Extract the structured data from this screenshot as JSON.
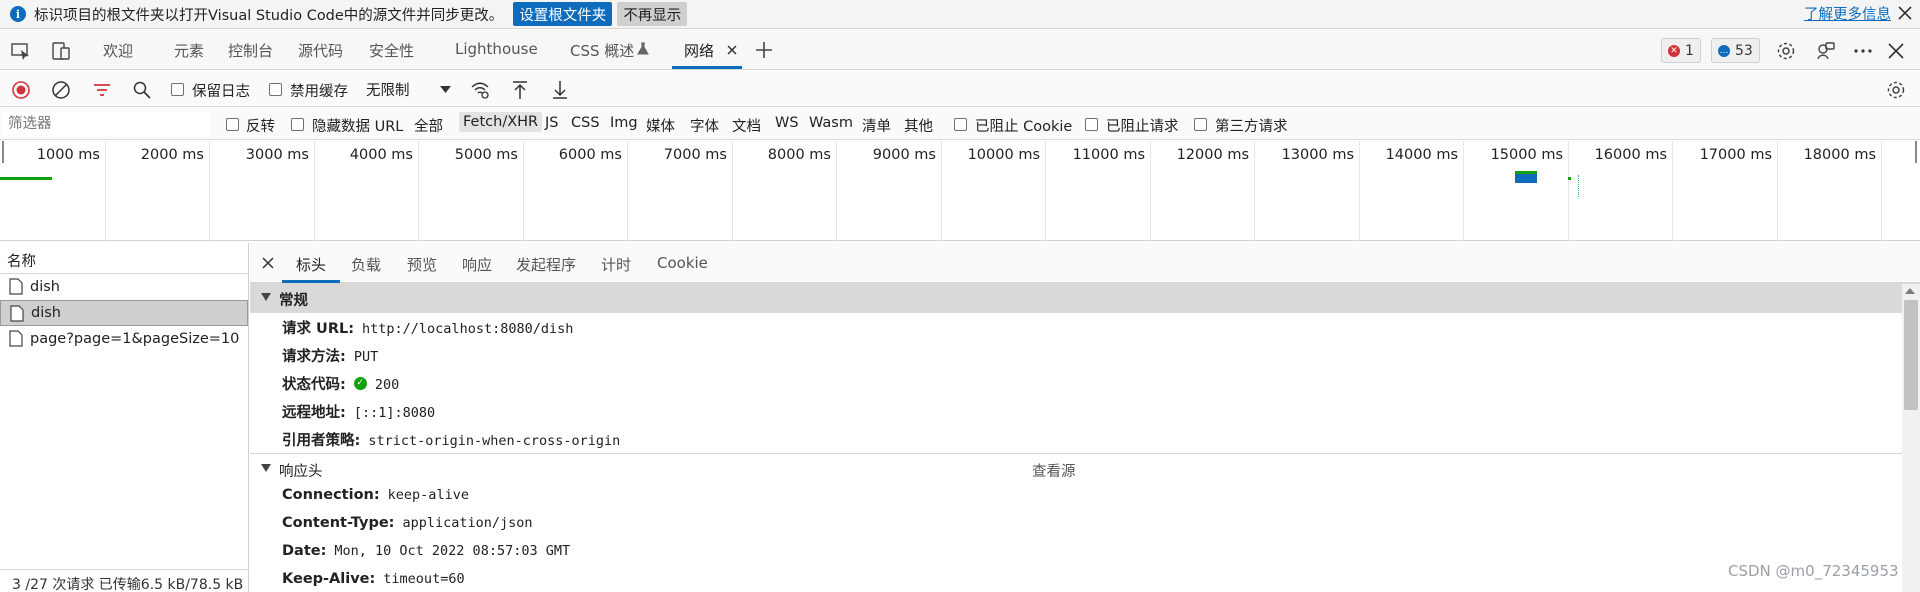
{
  "infobar": {
    "message": "标识项目的根文件夹以打开Visual Studio Code中的源文件并同步更改。",
    "primary_button": "设置根文件夹",
    "secondary_button": "不再显示",
    "learn_more": "了解更多信息"
  },
  "main_tabs": [
    "欢迎",
    "元素",
    "控制台",
    "源代码",
    "安全性",
    "Lighthouse",
    "CSS 概述",
    "网络"
  ],
  "active_tab": "网络",
  "badges": {
    "errors": "1",
    "issues": "53"
  },
  "toolbar": {
    "preserve_log": "保留日志",
    "disable_cache": "禁用缓存",
    "throttling": "无限制"
  },
  "filter": {
    "placeholder": "筛选器",
    "invert": "反转",
    "hide_data_urls": "隐藏数据 URL",
    "types": [
      "全部",
      "Fetch/XHR",
      "JS",
      "CSS",
      "Img",
      "媒体",
      "字体",
      "文档",
      "WS",
      "Wasm",
      "清单",
      "其他"
    ],
    "active_type": "Fetch/XHR",
    "blocked_cookies": "已阻止 Cookie",
    "blocked_requests": "已阻止请求",
    "third_party": "第三方请求"
  },
  "overview": {
    "ticks": [
      "1000 ms",
      "2000 ms",
      "3000 ms",
      "4000 ms",
      "5000 ms",
      "6000 ms",
      "7000 ms",
      "8000 ms",
      "9000 ms",
      "10000 ms",
      "11000 ms",
      "12000 ms",
      "13000 ms",
      "14000 ms",
      "15000 ms",
      "16000 ms",
      "17000 ms",
      "18000 ms"
    ]
  },
  "request_list": {
    "header": "名称",
    "items": [
      "dish",
      "dish",
      "page?page=1&pageSize=10"
    ],
    "selected_index": 1,
    "status": "3 /27 次请求  已传输6.5 kB/78.5 kB"
  },
  "details": {
    "tabs": [
      "标头",
      "负载",
      "预览",
      "响应",
      "发起程序",
      "计时",
      "Cookie"
    ],
    "active_tab": "标头",
    "general": {
      "title": "常规",
      "rows": [
        {
          "key": "请求 URL:",
          "value": "http://localhost:8080/dish"
        },
        {
          "key": "请求方法:",
          "value": "PUT"
        },
        {
          "key": "状态代码:",
          "value": "200"
        },
        {
          "key": "远程地址:",
          "value": "[::1]:8080"
        },
        {
          "key": "引用者策略:",
          "value": "strict-origin-when-cross-origin"
        }
      ]
    },
    "response_headers": {
      "title": "响应头",
      "view_source": "查看源",
      "rows": [
        {
          "key": "Connection:",
          "value": "keep-alive"
        },
        {
          "key": "Content-Type:",
          "value": "application/json"
        },
        {
          "key": "Date:",
          "value": "Mon, 10 Oct 2022 08:57:03 GMT"
        },
        {
          "key": "Keep-Alive:",
          "value": "timeout=60"
        }
      ]
    }
  },
  "watermark": "CSDN @m0_72345953",
  "colors": {
    "accent": "#0f6cbd",
    "record": "#d13438",
    "ok": "#13a10e"
  }
}
